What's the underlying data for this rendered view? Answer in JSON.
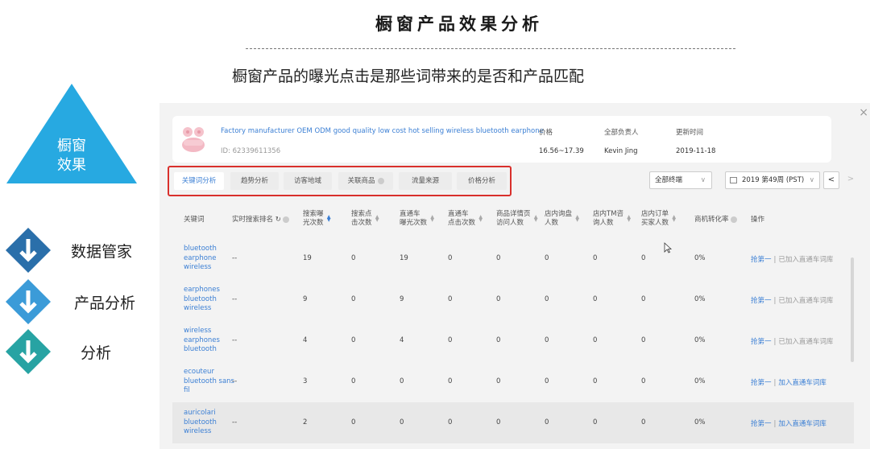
{
  "slide": {
    "title": "橱窗产品效果分析",
    "subtitle": "橱窗产品的曝光点击是那些词带来的是否和产品匹配"
  },
  "left_nav": {
    "triangle_label_line1": "橱窗",
    "triangle_label_line2": "效果",
    "items": [
      {
        "label": "数据管家",
        "color": "#2a6faa"
      },
      {
        "label": "产品分析",
        "color": "#3b9bd8"
      },
      {
        "label": "分析",
        "color": "#27a3a3"
      }
    ]
  },
  "product": {
    "name": "Factory manufacturer OEM ODM good quality low cost hot selling wireless bluetooth earphone",
    "id": "ID: 62339611356",
    "price_label": "价格",
    "price_value": "16.56~17.39",
    "owner_label": "全部负责人",
    "owner_value": "Kevin Jing",
    "updated_label": "更新时间",
    "updated_value": "2019-11-18"
  },
  "tabs": [
    {
      "label": "关键词分析",
      "active": true
    },
    {
      "label": "趋势分析",
      "active": false
    },
    {
      "label": "访客地域",
      "active": false
    },
    {
      "label": "关联商品",
      "active": false
    },
    {
      "label": "流量来源",
      "active": false
    },
    {
      "label": "价格分析",
      "active": false
    }
  ],
  "filters": {
    "terminal": "全部终端",
    "week": "2019 第49周 (PST)",
    "prev": "<",
    "next": ">"
  },
  "table": {
    "columns": [
      {
        "line1": "关键词",
        "line2": ""
      },
      {
        "line1": "实时搜索排名",
        "line2": ""
      },
      {
        "line1": "搜索曝",
        "line2": "光次数"
      },
      {
        "line1": "搜索点",
        "line2": "击次数"
      },
      {
        "line1": "直通车",
        "line2": "曝光次数"
      },
      {
        "line1": "直通车",
        "line2": "点击次数"
      },
      {
        "line1": "商品详情页",
        "line2": "访问人数"
      },
      {
        "line1": "店内询盘",
        "line2": "人数"
      },
      {
        "line1": "店内TM咨",
        "line2": "询人数"
      },
      {
        "line1": "店内订单",
        "line2": "买家人数"
      },
      {
        "line1": "商机转化率",
        "line2": ""
      },
      {
        "line1": "操作",
        "line2": ""
      }
    ],
    "rows": [
      {
        "kw1": "bluetooth",
        "kw2": "earphone",
        "kw3": "wireless",
        "rank": "--",
        "v1": "19",
        "v2": "0",
        "v3": "19",
        "v4": "0",
        "v5": "0",
        "v6": "0",
        "v7": "0",
        "v8": "0",
        "rate": "0%",
        "act1": "抢第一",
        "act2": "已加入直通车词库"
      },
      {
        "kw1": "earphones",
        "kw2": "bluetooth",
        "kw3": "wireless",
        "rank": "--",
        "v1": "9",
        "v2": "0",
        "v3": "9",
        "v4": "0",
        "v5": "0",
        "v6": "0",
        "v7": "0",
        "v8": "0",
        "rate": "0%",
        "act1": "抢第一",
        "act2": "已加入直通车词库"
      },
      {
        "kw1": "wireless",
        "kw2": "earphones",
        "kw3": "bluetooth",
        "rank": "--",
        "v1": "4",
        "v2": "0",
        "v3": "4",
        "v4": "0",
        "v5": "0",
        "v6": "0",
        "v7": "0",
        "v8": "0",
        "rate": "0%",
        "act1": "抢第一",
        "act2": "已加入直通车词库"
      },
      {
        "kw1": "ecouteur",
        "kw2": "bluetooth sans",
        "kw3": "fil",
        "rank": "--",
        "v1": "3",
        "v2": "0",
        "v3": "0",
        "v4": "0",
        "v5": "0",
        "v6": "0",
        "v7": "0",
        "v8": "0",
        "rate": "0%",
        "act1": "抢第一",
        "act2": "加入直通车词库"
      },
      {
        "kw1": "auricolari",
        "kw2": "bluetooth",
        "kw3": "wireless",
        "rank": "--",
        "v1": "2",
        "v2": "0",
        "v3": "0",
        "v4": "0",
        "v5": "0",
        "v6": "0",
        "v7": "0",
        "v8": "0",
        "rate": "0%",
        "act1": "抢第一",
        "act2": "加入直通车词库"
      }
    ],
    "separator": "|"
  },
  "icons": {
    "close": "×",
    "refresh": "↻"
  }
}
